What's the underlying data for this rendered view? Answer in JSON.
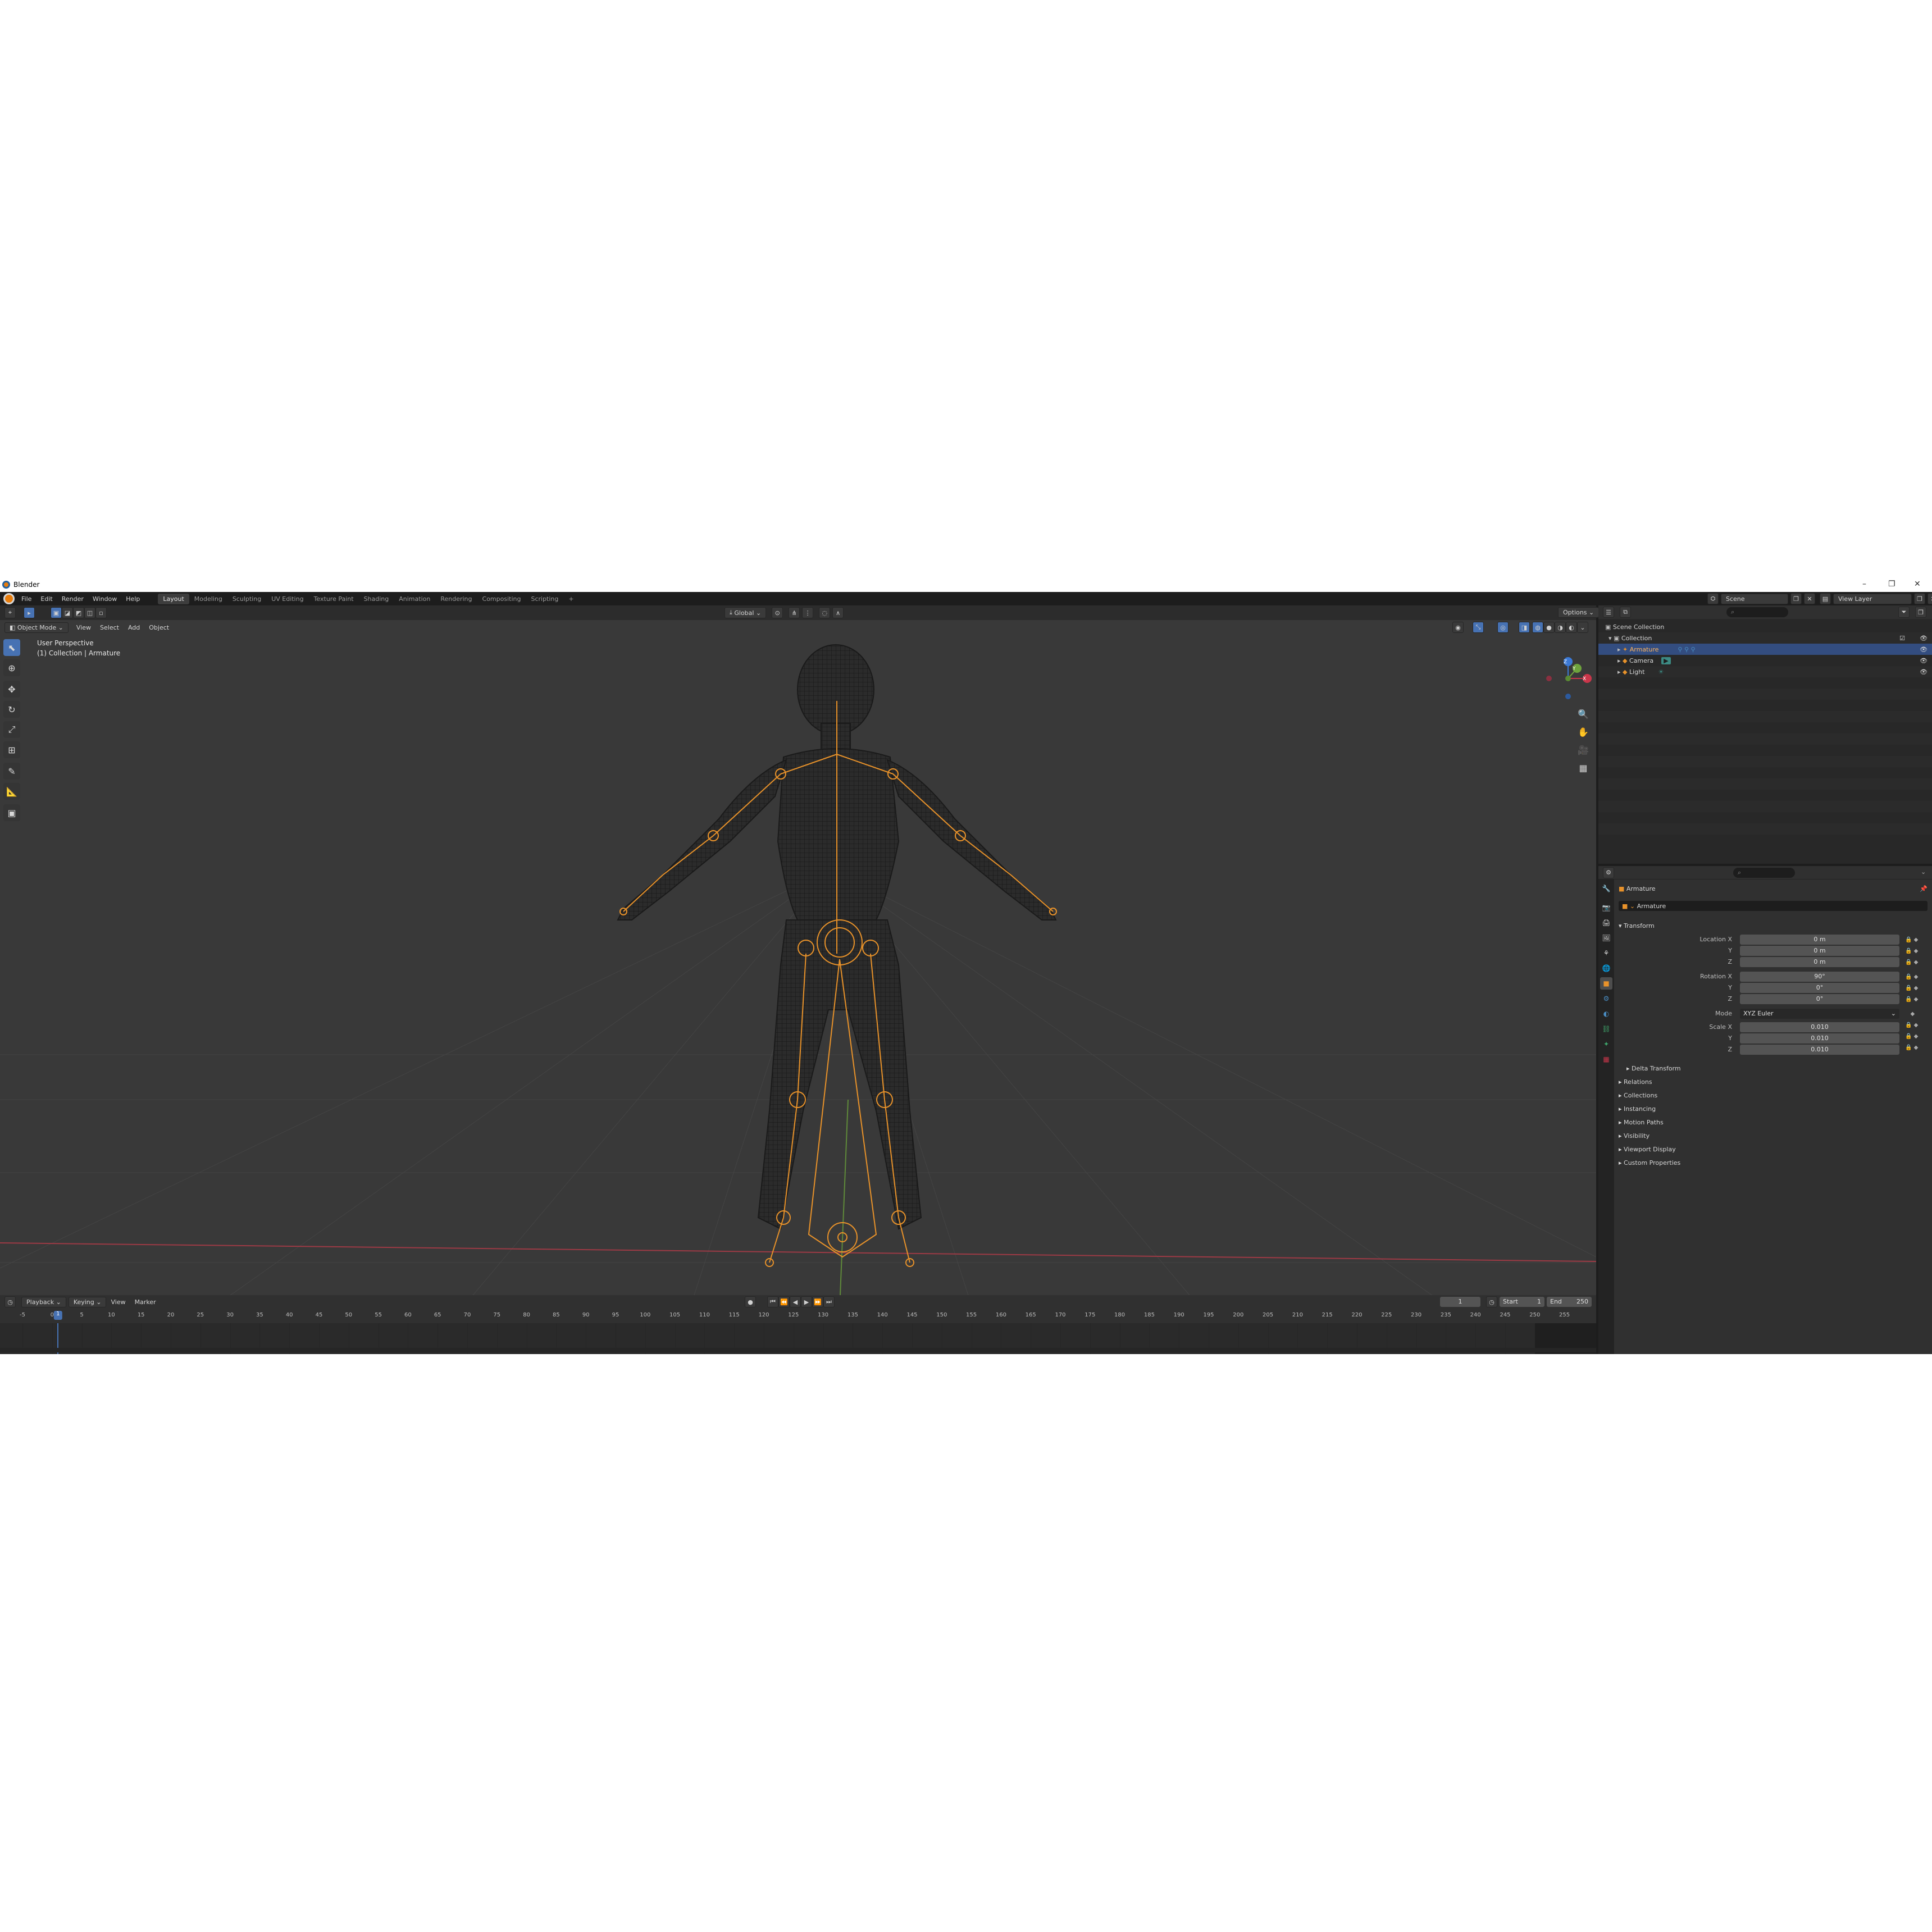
{
  "window": {
    "title": "Blender",
    "controls": [
      "–",
      "❐",
      "✕"
    ]
  },
  "menu": [
    "File",
    "Edit",
    "Render",
    "Window",
    "Help"
  ],
  "workspaces": [
    "Layout",
    "Modeling",
    "Sculpting",
    "UV Editing",
    "Texture Paint",
    "Shading",
    "Animation",
    "Rendering",
    "Compositing",
    "Scripting",
    "+"
  ],
  "active_workspace": "Layout",
  "scene": {
    "scene_name": "Scene",
    "view_layer": "View Layer"
  },
  "viewport": {
    "mode": "Object Mode",
    "menus": [
      "View",
      "Select",
      "Add",
      "Object"
    ],
    "orientation": "Global",
    "options": "Options",
    "overlay_line1": "User Perspective",
    "overlay_line2": "(1) Collection | Armature",
    "gizmo": {
      "x": "X",
      "y": "Y",
      "z": "Z"
    }
  },
  "outliner": {
    "root": "Scene Collection",
    "collection": "Collection",
    "items": [
      "Armature",
      "Camera",
      "Light"
    ],
    "selected": "Armature"
  },
  "properties": {
    "object_name": "Armature",
    "data_name": "Armature",
    "transform_header": "Transform",
    "location": {
      "label": "Location X",
      "x": "0 m",
      "y": "0 m",
      "z": "0 m"
    },
    "rotation": {
      "label": "Rotation X",
      "x": "90°",
      "y": "0°",
      "z": "0°"
    },
    "mode_label": "Mode",
    "mode_value": "XYZ Euler",
    "scale": {
      "label": "Scale X",
      "x": "0.010",
      "y": "0.010",
      "z": "0.010"
    },
    "axis_y": "Y",
    "axis_z": "Z",
    "delta": "Delta Transform",
    "panels": [
      "Relations",
      "Collections",
      "Instancing",
      "Motion Paths",
      "Visibility",
      "Viewport Display",
      "Custom Properties"
    ]
  },
  "timeline": {
    "menus": [
      "Playback",
      "Keying",
      "View",
      "Marker"
    ],
    "current_frame": "1",
    "start_label": "Start",
    "start": "1",
    "end_label": "End",
    "end": "250",
    "ticks": [
      "-5",
      "0",
      "5",
      "10",
      "15",
      "20",
      "25",
      "30",
      "35",
      "40",
      "45",
      "50",
      "55",
      "60",
      "65",
      "70",
      "75",
      "80",
      "85",
      "90",
      "95",
      "100",
      "105",
      "110",
      "115",
      "120",
      "125",
      "130",
      "135",
      "140",
      "145",
      "150",
      "155",
      "160",
      "165",
      "170",
      "175",
      "180",
      "185",
      "190",
      "195",
      "200",
      "205",
      "210",
      "215",
      "220",
      "225",
      "230",
      "235",
      "240",
      "245",
      "250",
      "255"
    ],
    "playhead": "1"
  },
  "colors": {
    "accent": "#4772b3",
    "armature": "#e8922a",
    "x_axis": "#c9364a",
    "y_axis": "#6ea33d",
    "z_axis": "#3b79d6"
  }
}
